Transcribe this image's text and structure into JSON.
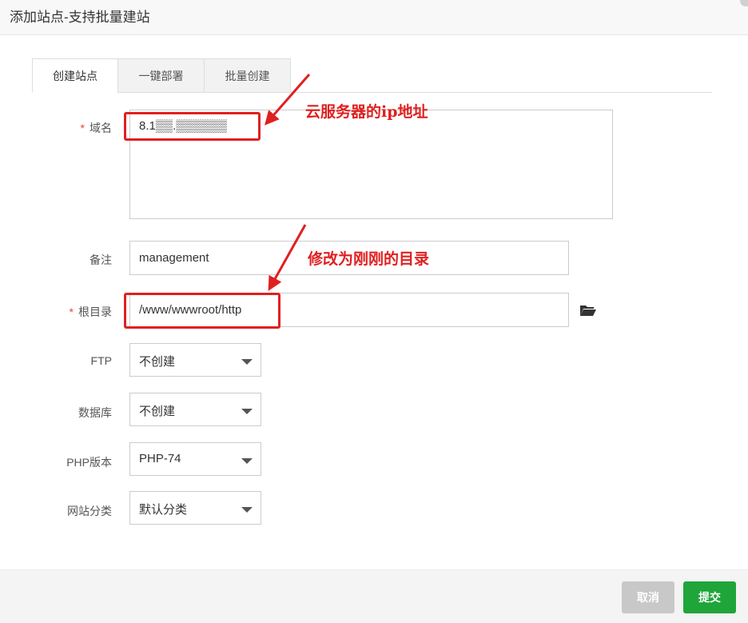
{
  "dialog": {
    "title": "添加站点-支持批量建站"
  },
  "tabs": [
    {
      "label": "创建站点",
      "active": true
    },
    {
      "label": "一键部署",
      "active": false
    },
    {
      "label": "批量创建",
      "active": false
    }
  ],
  "form": {
    "required_mark": "*",
    "domain": {
      "label": "域名",
      "value": "8.1▒▒.▒▒▒▒▒▒"
    },
    "remark": {
      "label": "备注",
      "value": "management"
    },
    "root": {
      "label": "根目录",
      "value": "/www/wwwroot/http",
      "browse_icon": "folder-open-icon"
    },
    "ftp": {
      "label": "FTP",
      "selected": "不创建"
    },
    "database": {
      "label": "数据库",
      "selected": "不创建"
    },
    "php": {
      "label": "PHP版本",
      "selected": "PHP-74"
    },
    "category": {
      "label": "网站分类",
      "selected": "默认分类"
    }
  },
  "annotations": {
    "domain_note": "云服务器的ip地址",
    "root_note": "修改为刚刚的目录",
    "color": "#e02020"
  },
  "footer": {
    "cancel_label": "取消",
    "submit_label": "提交"
  },
  "colors": {
    "accent": "#20a53a",
    "cancel": "#c8c8c8"
  }
}
